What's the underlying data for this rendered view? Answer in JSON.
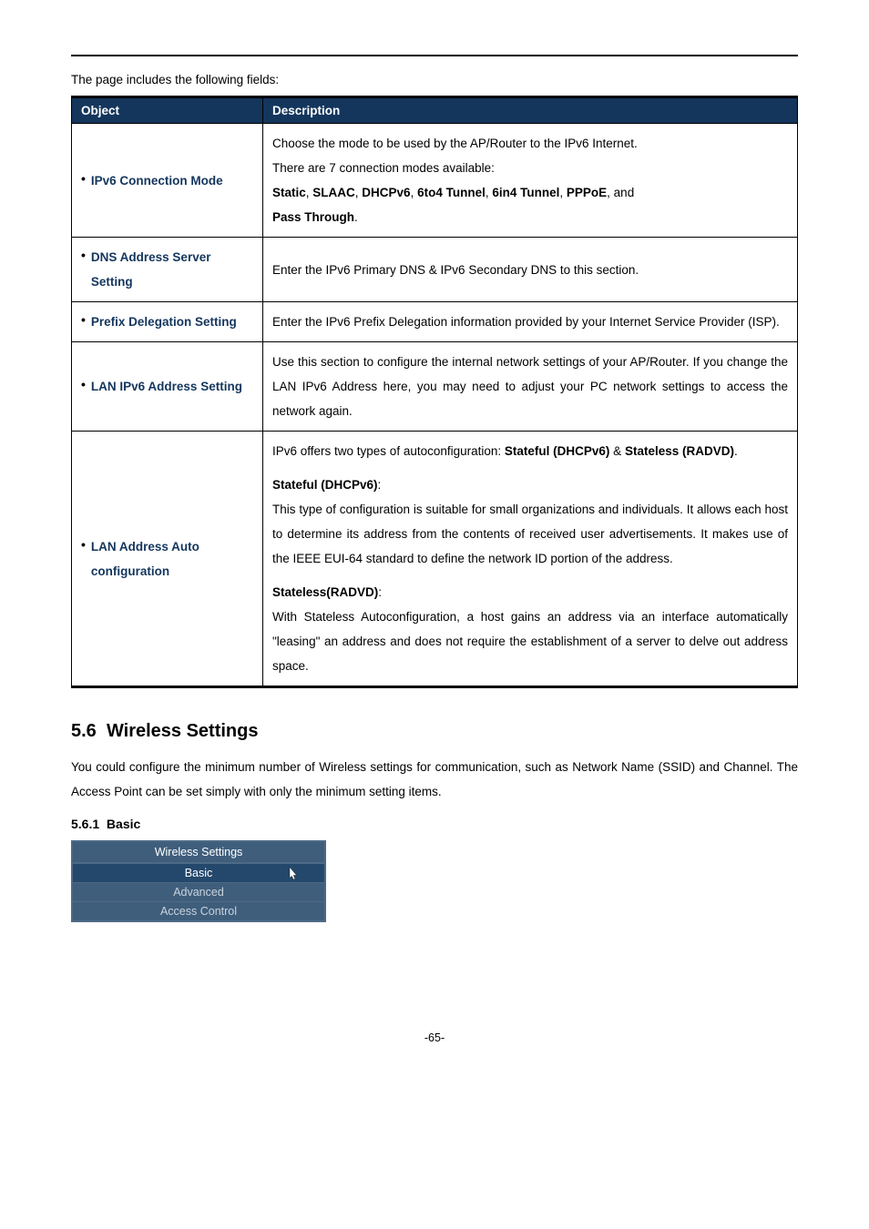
{
  "intro": "The page includes the following fields:",
  "table": {
    "headers": {
      "object": "Object",
      "description": "Description"
    },
    "rows": [
      {
        "object": "IPv6 Connection Mode",
        "desc": {
          "l1": "Choose the mode to be used by the AP/Router to the IPv6 Internet.",
          "l2": "There are 7 connection modes available:",
          "l3a": "Static",
          "l3b": "SLAAC",
          "l3c": "DHCPv6",
          "l3d": "6to4 Tunnel",
          "l3e": "6in4 Tunnel",
          "l3f": "PPPoE",
          "l3_and": ", and",
          "l4": "Pass Through",
          "l4_end": "."
        }
      },
      {
        "object": "DNS Address Server Setting",
        "desc": "Enter the IPv6 Primary DNS & IPv6 Secondary DNS to this section."
      },
      {
        "object": "Prefix Delegation Setting",
        "desc": "Enter the IPv6 Prefix Delegation information provided by your Internet Service Provider (ISP)."
      },
      {
        "object": "LAN IPv6 Address Setting",
        "desc": "Use this section to configure the internal network settings of your AP/Router. If you change the LAN IPv6 Address here, you may need to adjust your PC network settings to access the network again."
      },
      {
        "object": "LAN Address Auto configuration",
        "desc": {
          "p1a": "IPv6 offers two types of autoconfiguration: ",
          "p1b": "Stateful (DHCPv6)",
          "p1c": " & ",
          "p1d": "Stateless (RADVD)",
          "p1e": ".",
          "h1": "Stateful (DHCPv6)",
          "h1colon": ":",
          "b1": "This type of configuration is suitable for small organizations and individuals. It allows each host to determine its address from the contents of received user advertisements. It makes use of the IEEE EUI-64 standard to define the network ID portion of the address.",
          "h2": "Stateless(RADVD)",
          "h2colon": ":",
          "b2": "With Stateless Autoconfiguration, a host gains an address via an interface automatically \"leasing\" an address and does not require the establishment of a server to delve out address space."
        }
      }
    ]
  },
  "section": {
    "num": "5.6",
    "title": "Wireless Settings",
    "body": "You could configure the minimum number of Wireless settings for communication, such as Network Name (SSID) and Channel. The Access Point can be set simply with only the minimum setting items."
  },
  "subsection": {
    "num": "5.6.1",
    "title": "Basic"
  },
  "menu": {
    "title": "Wireless Settings",
    "items": [
      "Basic",
      "Advanced",
      "Access Control"
    ]
  },
  "pagenum": "-65-"
}
